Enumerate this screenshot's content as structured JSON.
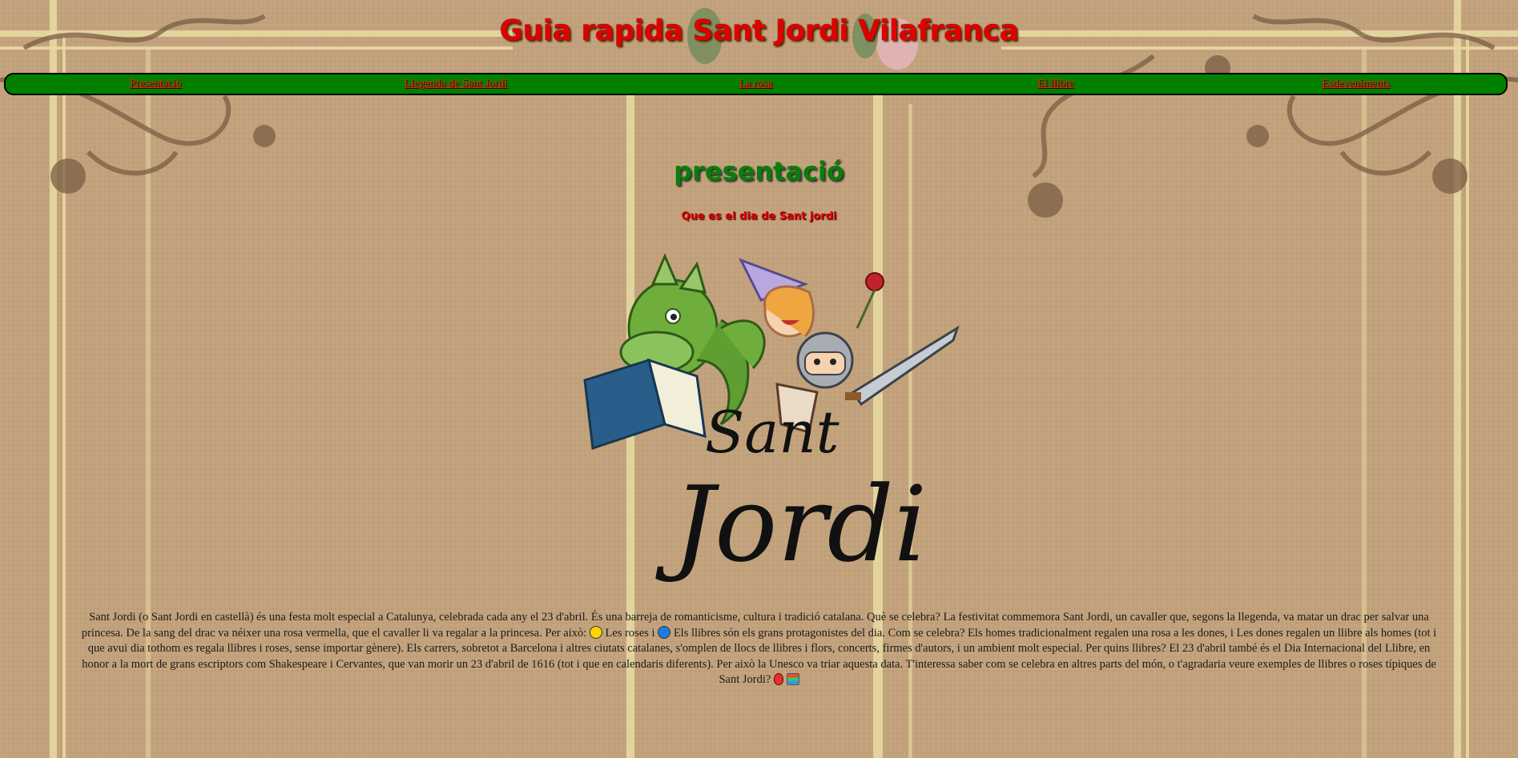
{
  "site": {
    "title": "Guia rapida Sant Jordi Vilafranca"
  },
  "nav": {
    "items": [
      {
        "label": "Presentació"
      },
      {
        "label": "Llegenda de Sant Jordi"
      },
      {
        "label": "La rosa"
      },
      {
        "label": "El llibre"
      },
      {
        "label": "Esdeveniments"
      }
    ]
  },
  "main": {
    "section_title": "presentació",
    "subtitle": "Que es el dia de Sant jordi",
    "illustration": {
      "logo_text_line1": "Sant",
      "logo_text_line2": "Jordi"
    },
    "paragraph": {
      "part1": "Sant Jordi (o Sant Jordi en castellà) és una festa molt especial a Catalunya, celebrada cada any el 23 d'abril. És una barreja de romanticisme, cultura i tradició catalana. Què se celebra? La festivitat commemora Sant Jordi, un cavaller que, segons la llegenda, va matar un drac per salvar una princesa. De la sang del drac va néixer una rosa vermella, que el cavaller li va regalar a la princesa. Per això: ",
      "part2": " Les roses i ",
      "part3": " Els llibres són els grans protagonistes del dia. Com se celebra? Els homes tradicionalment regalen una rosa a les dones, i Les dones regalen un llibre als homes (tot i que avui dia tothom es regala llibres i roses, sense importar gènere). Els carrers, sobretot a Barcelona i altres ciutats catalanes, s'omplen de llocs de llibres i flors, concerts, firmes d'autors, i un ambient molt especial. Per quins llibres? El 23 d'abril també és el Dia Internacional del Llibre, en honor a la mort de grans escriptors com Shakespeare i Cervantes, que van morir un 23 d'abril de 1616 (tot i que en calendaris diferents). Per això la Unesco va triar aquesta data. T'interessa saber com se celebra en altres parts del món, o t'agradaria veure exemples de llibres o roses típiques de Sant Jordi? "
    }
  },
  "colors": {
    "background": "#c2a27c",
    "nav_background": "#008000",
    "title_red": "#e00000",
    "section_green": "#0a7d0a"
  }
}
